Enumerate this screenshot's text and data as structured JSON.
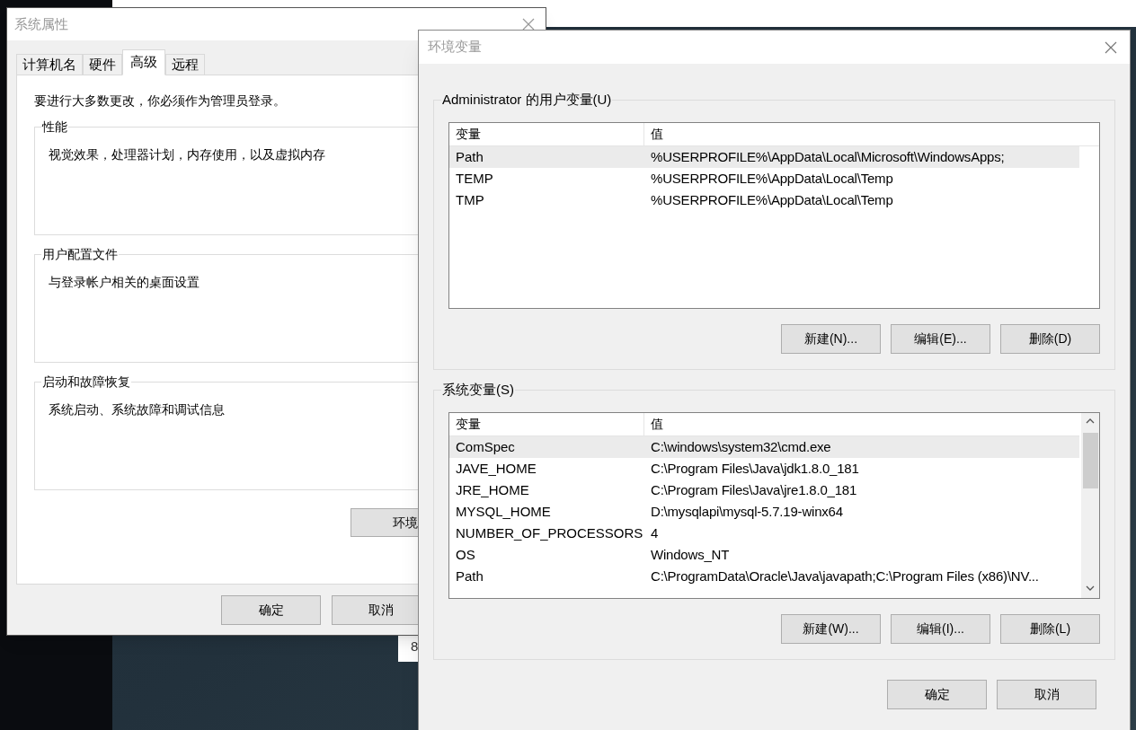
{
  "background_window": {
    "fragment_text": "8"
  },
  "system_properties": {
    "title": "系统属性",
    "tabs": [
      {
        "label": "计算机名",
        "selected": false
      },
      {
        "label": "硬件",
        "selected": false
      },
      {
        "label": "高级",
        "selected": true
      },
      {
        "label": "远程",
        "selected": false
      }
    ],
    "notice": "要进行大多数更改，你必须作为管理员登录。",
    "groups": [
      {
        "title": "性能",
        "description": "视觉效果，处理器计划，内存使用，以及虚拟内存"
      },
      {
        "title": "用户配置文件",
        "description": "与登录帐户相关的桌面设置"
      },
      {
        "title": "启动和故障恢复",
        "description": "系统启动、系统故障和调试信息"
      }
    ],
    "env_button": "环境",
    "buttons": [
      "确定",
      "取消"
    ]
  },
  "environment_variables": {
    "title": "环境变量",
    "sections": [
      {
        "title": "Administrator 的用户变量(U)",
        "columns": [
          "变量",
          "值"
        ],
        "scrollbar": false,
        "rows": [
          {
            "name": "Path",
            "value": "%USERPROFILE%\\AppData\\Local\\Microsoft\\WindowsApps;",
            "selected": true
          },
          {
            "name": "TEMP",
            "value": "%USERPROFILE%\\AppData\\Local\\Temp",
            "selected": false
          },
          {
            "name": "TMP",
            "value": "%USERPROFILE%\\AppData\\Local\\Temp",
            "selected": false
          }
        ],
        "buttons": [
          "新建(N)...",
          "编辑(E)...",
          "删除(D)"
        ]
      },
      {
        "title": "系统变量(S)",
        "columns": [
          "变量",
          "值"
        ],
        "scrollbar": true,
        "rows": [
          {
            "name": "ComSpec",
            "value": "C:\\windows\\system32\\cmd.exe",
            "selected": true
          },
          {
            "name": "JAVE_HOME",
            "value": "C:\\Program Files\\Java\\jdk1.8.0_181",
            "selected": false
          },
          {
            "name": "JRE_HOME",
            "value": "C:\\Program Files\\Java\\jre1.8.0_181",
            "selected": false
          },
          {
            "name": "MYSQL_HOME",
            "value": "D:\\mysqlapi\\mysql-5.7.19-winx64",
            "selected": false
          },
          {
            "name": "NUMBER_OF_PROCESSORS",
            "value": "4",
            "selected": false
          },
          {
            "name": "OS",
            "value": "Windows_NT",
            "selected": false
          },
          {
            "name": "Path",
            "value": "C:\\ProgramData\\Oracle\\Java\\javapath;C:\\Program Files (x86)\\NV...",
            "selected": false
          }
        ],
        "buttons": [
          "新建(W)...",
          "编辑(I)...",
          "删除(L)"
        ]
      }
    ],
    "buttons": [
      "确定",
      "取消"
    ]
  }
}
